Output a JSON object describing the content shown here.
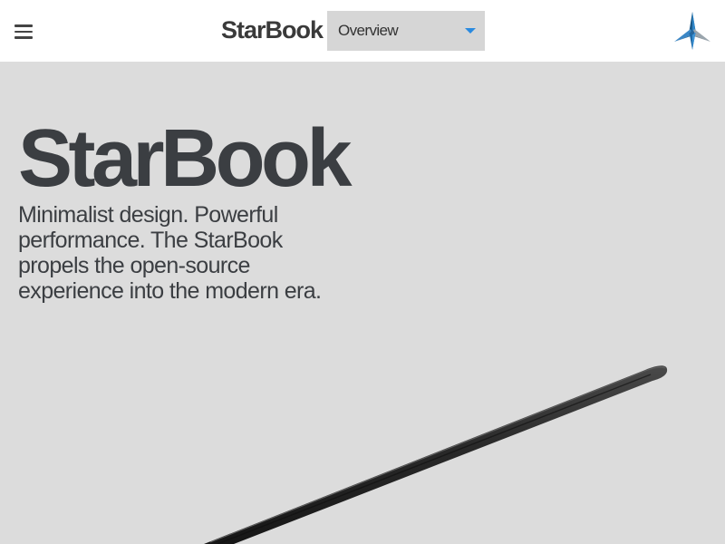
{
  "header": {
    "menu_icon": "hamburger-menu-icon",
    "brand": "StarBook",
    "nav_select": {
      "selected": "Overview",
      "caret_color": "#2a8ae0"
    },
    "logo_icon": "star-logo-icon"
  },
  "hero": {
    "title": "StarBook",
    "text": "Minimalist design. Powerful performance. The StarBook propels the open-source experience into the modern era.",
    "image": "laptop-side-profile"
  },
  "colors": {
    "header_bg": "#ffffff",
    "hero_bg": "#dcdcdc",
    "text": "#3b3e42",
    "accent": "#2a8ae0"
  }
}
